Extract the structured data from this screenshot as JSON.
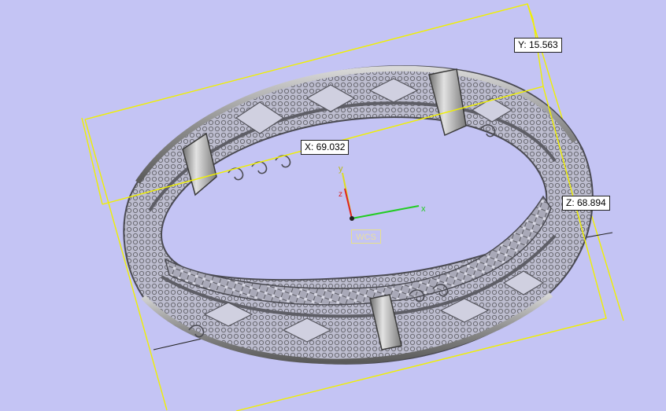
{
  "viewport": {
    "background_color": "#c4c4f4",
    "bounding_box_color": "#f0f000",
    "model_color": "#8a8a8a"
  },
  "dimensions": {
    "x_label": "X: 69.032",
    "y_label": "Y: 15.563",
    "z_label": "Z: 68.894"
  },
  "triad": {
    "x_axis_label": "x",
    "y_axis_label": "y",
    "z_axis_label": "z",
    "wcs_label": "WCS",
    "x_color": "#22cc22",
    "y_color": "#dddd22",
    "z_color": "#dd2222"
  }
}
